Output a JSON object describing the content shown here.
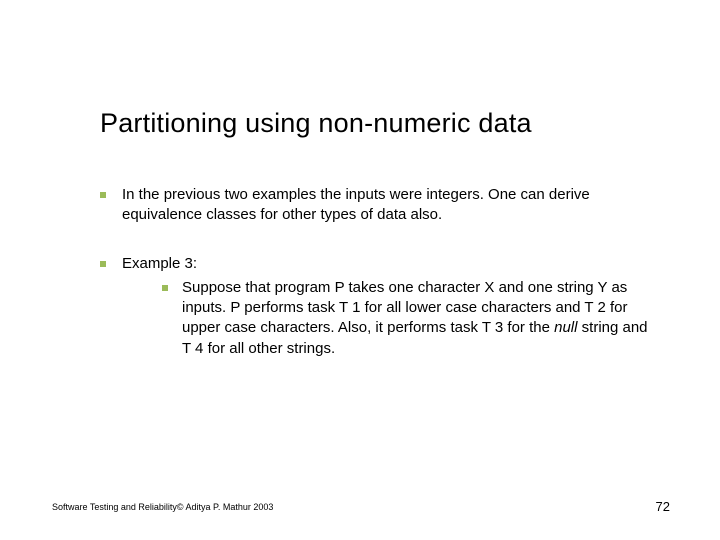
{
  "title": "Partitioning using non-numeric data",
  "bullets": [
    {
      "text": "In the previous two examples the inputs were integers. One can derive equivalence classes for other types of data also."
    },
    {
      "text": "Example 3:",
      "sub": [
        {
          "pre": "Suppose that program P takes one character X and one string Y as inputs. P performs task T 1 for all lower case characters and T 2 for upper case characters. Also, it performs task T 3 for the ",
          "em": "null",
          "post": " string and T 4 for all other strings."
        }
      ]
    }
  ],
  "footer": {
    "left": "Software Testing and Reliability© Aditya P. Mathur 2003",
    "page": "72"
  }
}
